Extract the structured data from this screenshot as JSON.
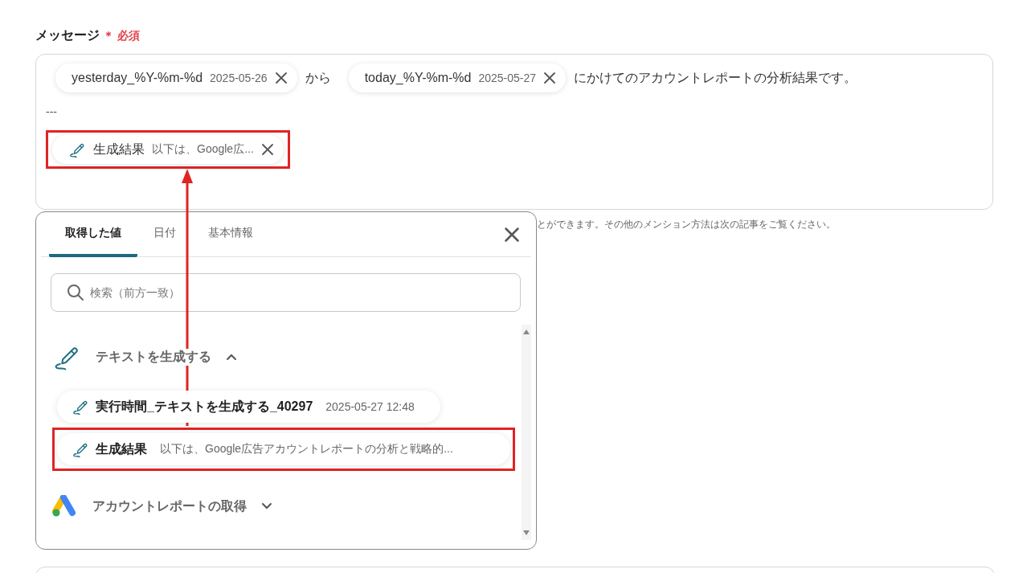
{
  "field": {
    "label": "メッセージ",
    "required_mark": "＊",
    "required_text": "必須"
  },
  "message": {
    "lines": [
      [
        {
          "kind": "chip",
          "name": "yesterday_%Y-%m-%d",
          "value": "2025-05-26",
          "highlighted": false
        },
        {
          "kind": "text",
          "text": "から"
        },
        {
          "kind": "chip",
          "name": "today_%Y-%m-%d",
          "value": "2025-05-27",
          "highlighted": false
        },
        {
          "kind": "text",
          "text": "にかけてのアカウントレポートの分析結果です。"
        }
      ],
      [
        {
          "kind": "text",
          "text": "---"
        }
      ],
      [
        {
          "kind": "generated",
          "name": "生成結果",
          "value": "以下は、Google広...",
          "highlighted": true
        }
      ]
    ]
  },
  "hint": "とができます。その他のメンション方法は次の記事をご覧ください。",
  "picker": {
    "tabs": [
      {
        "label": "取得した値",
        "selected": true
      },
      {
        "label": "日付",
        "selected": false
      },
      {
        "label": "基本情報",
        "selected": false
      }
    ],
    "search": {
      "placeholder": "検索（前方一致）"
    },
    "groups": [
      {
        "kind": "text-gen",
        "title": "テキストを生成する",
        "expanded": true,
        "items": [
          {
            "name": "実行時間_テキストを生成する_40297",
            "value": "2025-05-27 12:48",
            "highlighted": false
          },
          {
            "name": "生成結果",
            "value": "以下は、Google広告アカウントレポートの分析と戦略的...",
            "highlighted": true
          }
        ]
      },
      {
        "kind": "ads",
        "title": "アカウントレポートの取得",
        "expanded": false
      }
    ]
  }
}
